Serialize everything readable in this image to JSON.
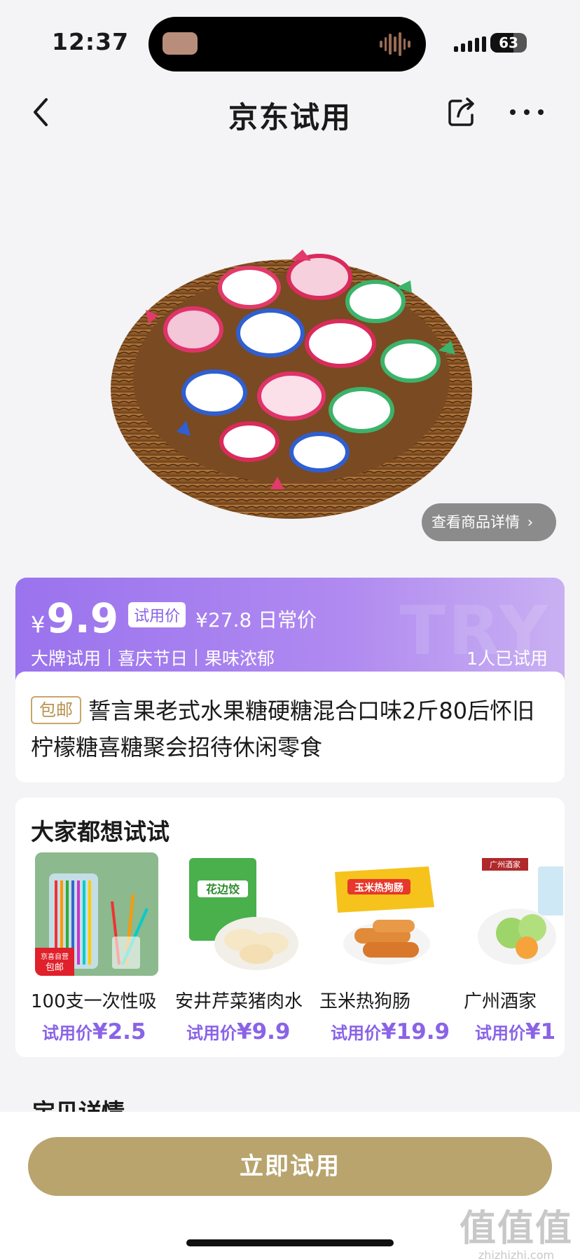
{
  "status_bar": {
    "time": "12:37",
    "battery": "63",
    "battery_level": 0.63
  },
  "nav": {
    "title": "京东试用"
  },
  "hero": {
    "detail_button": "查看商品详情"
  },
  "price_card": {
    "currency": "¥",
    "price": "9.9",
    "trial_tag": "试用价",
    "regular_price": "¥27.8 日常价",
    "tags": [
      "大牌试用",
      "喜庆节日",
      "果味浓郁"
    ],
    "tried_count": "1人已试用"
  },
  "product": {
    "free_shipping": "包邮",
    "title": "誓言果老式水果糖硬糖混合口味2斤80后怀旧柠檬糖喜糖聚会招待休闲零食"
  },
  "recommend": {
    "title": "大家都想试试",
    "items": [
      {
        "name": "100支一次性吸",
        "price_label": "试用价",
        "price": "¥2.5",
        "badge": "京喜自营\n包邮"
      },
      {
        "name": "安井芹菜猪肉水",
        "price_label": "试用价",
        "price": "¥9.9",
        "pack_text": "花边饺"
      },
      {
        "name": "玉米热狗肠",
        "price_label": "试用价",
        "price": "¥19.9",
        "pack_text": "玉米热狗肠"
      },
      {
        "name": "广州酒家",
        "price_label": "试用价",
        "price": "¥1",
        "pack_text": "广州酒家"
      }
    ]
  },
  "detail_section": {
    "title": "宝贝详情"
  },
  "cta": {
    "label": "立即试用"
  },
  "watermark": {
    "big": "值值值",
    "small": "zhizhizhi.com"
  },
  "colors": {
    "accent": "#9a73ee",
    "gold": "#b9a46e",
    "price_purple": "#8a63e6"
  }
}
